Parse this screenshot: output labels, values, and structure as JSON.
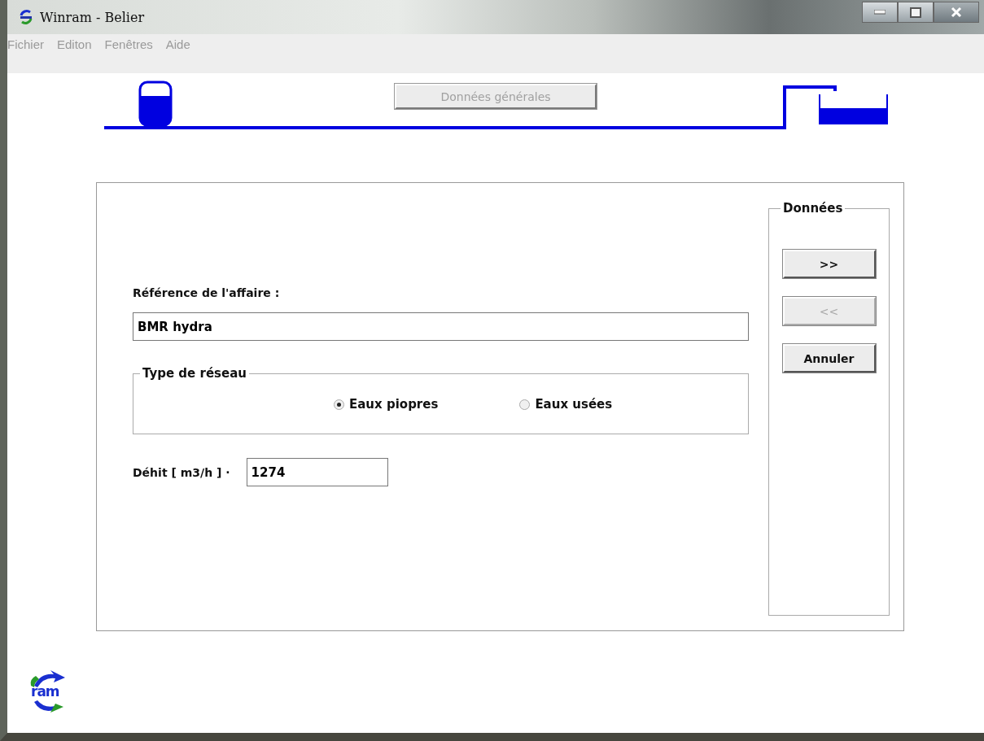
{
  "window": {
    "title": "Winram - Belier"
  },
  "menu": [
    "Fichier",
    "Editon",
    "Fenêtres",
    "Aide"
  ],
  "header_button": {
    "label": "Données générales",
    "disabled": true
  },
  "form": {
    "reference_label": "Référence de l'affaire :",
    "reference_value": "BMR hydra",
    "network_group": {
      "title": "Type de réseau",
      "options": [
        {
          "label": "Eaux piopres",
          "selected": true
        },
        {
          "label": "Eaux usées",
          "selected": false
        }
      ]
    },
    "flow_label": "Déhit [ m3/h ] ·",
    "flow_value": "1274"
  },
  "data_group": {
    "title": "Données",
    "buttons": [
      {
        "label": ">>",
        "disabled": false
      },
      {
        "label": "<<",
        "disabled": true
      },
      {
        "label": "Annuler",
        "disabled": false
      }
    ]
  },
  "logo": {
    "text": "ram"
  }
}
